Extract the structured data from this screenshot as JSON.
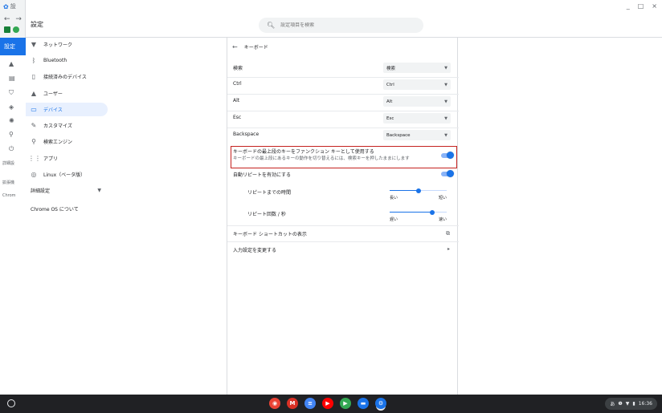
{
  "background_window": {
    "tab_label": "設",
    "nav_glyphs": "← →"
  },
  "window": {
    "title": "設定",
    "controls": {
      "minimize": "_",
      "maximize": "□",
      "close": "×"
    }
  },
  "search": {
    "placeholder": "設定項目を検索"
  },
  "rail": {
    "active_label": "設定",
    "texts": [
      "詳細設",
      "拡張機",
      "Chrom"
    ]
  },
  "sidebar": {
    "items": [
      {
        "label": "ネットワーク",
        "icon": "wifi-icon"
      },
      {
        "label": "Bluetooth",
        "icon": "bluetooth-icon"
      },
      {
        "label": "接続済みのデバイス",
        "icon": "phone-icon"
      },
      {
        "label": "ユーザー",
        "icon": "person-icon"
      },
      {
        "label": "デバイス",
        "icon": "laptop-icon",
        "active": true
      },
      {
        "label": "カスタマイズ",
        "icon": "brush-icon"
      },
      {
        "label": "検索エンジン",
        "icon": "search-icon"
      },
      {
        "label": "アプリ",
        "icon": "apps-icon"
      },
      {
        "label": "Linux（ベータ版）",
        "icon": "linux-icon"
      },
      {
        "label": "詳細設定",
        "icon": "chevron-down-icon"
      },
      {
        "label": "Chrome OS について",
        "icon": ""
      }
    ]
  },
  "keyboard": {
    "header": "キーボード",
    "remaps": [
      {
        "label": "検索",
        "value": "検索"
      },
      {
        "label": "Ctrl",
        "value": "Ctrl"
      },
      {
        "label": "Alt",
        "value": "Alt"
      },
      {
        "label": "Esc",
        "value": "Esc"
      },
      {
        "label": "Backspace",
        "value": "Backspace"
      }
    ],
    "function_keys": {
      "title": "キーボードの最上段のキーをファンクション キーとして使用する",
      "subtitle": "キーボードの最上段にあるキーの動作を切り替えるには、検索キーを押したままにします",
      "enabled": true
    },
    "auto_repeat": {
      "label": "自動リピートを有効にする",
      "enabled": true
    },
    "repeat_delay": {
      "label": "リピートまでの時間",
      "min_label": "長い",
      "max_label": "短い",
      "value_fraction": 0.5
    },
    "repeat_rate": {
      "label": "リピート回数 / 秒",
      "min_label": "遅い",
      "max_label": "速い",
      "value_fraction": 0.75
    },
    "shortcuts_link": "キーボード ショートカットの表示",
    "input_settings_link": "入力設定を変更する"
  },
  "shelf": {
    "apps": [
      {
        "name": "chrome",
        "color": "#ea4335",
        "glyph": "◉"
      },
      {
        "name": "gmail",
        "color": "#d93025",
        "glyph": "M"
      },
      {
        "name": "docs",
        "color": "#4285f4",
        "glyph": "≡"
      },
      {
        "name": "youtube",
        "color": "#ff0000",
        "glyph": "▶"
      },
      {
        "name": "play-store",
        "color": "#34a853",
        "glyph": "▶"
      },
      {
        "name": "messages",
        "color": "#1a73e8",
        "glyph": "▬"
      },
      {
        "name": "settings",
        "color": "#1a73e8",
        "glyph": "⚙"
      }
    ],
    "tray": {
      "ime": "あ",
      "time": "16:36"
    }
  }
}
